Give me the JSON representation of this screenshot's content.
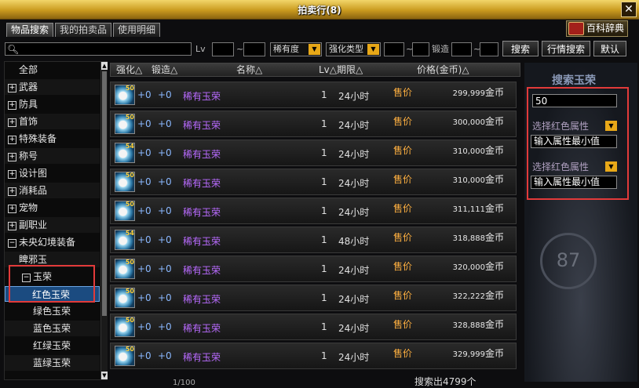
{
  "window": {
    "title": "拍卖行(8)",
    "close_symbol": "✕"
  },
  "tabs": [
    "物品搜索",
    "我的拍卖品",
    "使用明细"
  ],
  "encyclopedia": "百科辞典",
  "search": {
    "placeholder": "",
    "lv_label": "Lv",
    "lv_sep": "~",
    "rarity_label": "稀有度",
    "enhance_type_label": "强化类型",
    "forge_label": "锻造",
    "search_button": "搜索",
    "market_button": "行情搜索",
    "default_button": "默认"
  },
  "categories": [
    {
      "label": "全部",
      "box": ""
    },
    {
      "label": "武器",
      "box": "+"
    },
    {
      "label": "防具",
      "box": "+"
    },
    {
      "label": "首饰",
      "box": "+"
    },
    {
      "label": "特殊装备",
      "box": "+"
    },
    {
      "label": "称号",
      "box": "+"
    },
    {
      "label": "设计图",
      "box": "+"
    },
    {
      "label": "消耗品",
      "box": "+"
    },
    {
      "label": "宠物",
      "box": "+"
    },
    {
      "label": "副职业",
      "box": "+"
    },
    {
      "label": "未央幻境装备",
      "box": "−"
    },
    {
      "label": "睥邪玉",
      "box": ""
    },
    {
      "label": "玉荣",
      "box": "−"
    },
    {
      "label": "红色玉荣",
      "box": ""
    },
    {
      "label": "绿色玉荣",
      "box": ""
    },
    {
      "label": "蓝色玉荣",
      "box": ""
    },
    {
      "label": "红绿玉荣",
      "box": ""
    },
    {
      "label": "蓝绿玉荣",
      "box": ""
    }
  ],
  "table": {
    "headers": {
      "enhance": "强化△",
      "forge": "锻造△",
      "name": "名称△",
      "lv": "Lv△",
      "period": "期限△",
      "price": "价格(金币)△"
    },
    "rows": [
      {
        "level": "50",
        "enhance": "+0",
        "forge": "+0",
        "name": "稀有玉荣",
        "lv": "1",
        "period": "24小时",
        "price_label": "售价",
        "price": "299,999",
        "currency": "金币"
      },
      {
        "level": "50",
        "enhance": "+0",
        "forge": "+0",
        "name": "稀有玉荣",
        "lv": "1",
        "period": "24小时",
        "price_label": "售价",
        "price": "300,000",
        "currency": "金币"
      },
      {
        "level": "54",
        "enhance": "+0",
        "forge": "+0",
        "name": "稀有玉荣",
        "lv": "1",
        "period": "24小时",
        "price_label": "售价",
        "price": "310,000",
        "currency": "金币"
      },
      {
        "level": "50",
        "enhance": "+0",
        "forge": "+0",
        "name": "稀有玉荣",
        "lv": "1",
        "period": "24小时",
        "price_label": "售价",
        "price": "310,000",
        "currency": "金币"
      },
      {
        "level": "50",
        "enhance": "+0",
        "forge": "+0",
        "name": "稀有玉荣",
        "lv": "1",
        "period": "24小时",
        "price_label": "售价",
        "price": "311,111",
        "currency": "金币"
      },
      {
        "level": "54",
        "enhance": "+0",
        "forge": "+0",
        "name": "稀有玉荣",
        "lv": "1",
        "period": "48小时",
        "price_label": "售价",
        "price": "318,888",
        "currency": "金币"
      },
      {
        "level": "50",
        "enhance": "+0",
        "forge": "+0",
        "name": "稀有玉荣",
        "lv": "1",
        "period": "24小时",
        "price_label": "售价",
        "price": "320,000",
        "currency": "金币"
      },
      {
        "level": "50",
        "enhance": "+0",
        "forge": "+0",
        "name": "稀有玉荣",
        "lv": "1",
        "period": "24小时",
        "price_label": "售价",
        "price": "322,222",
        "currency": "金币"
      },
      {
        "level": "50",
        "enhance": "+0",
        "forge": "+0",
        "name": "稀有玉荣",
        "lv": "1",
        "period": "24小时",
        "price_label": "售价",
        "price": "328,888",
        "currency": "金币"
      },
      {
        "level": "50",
        "enhance": "+0",
        "forge": "+0",
        "name": "稀有玉荣",
        "lv": "1",
        "period": "24小时",
        "price_label": "售价",
        "price": "329,999",
        "currency": "金币"
      }
    ]
  },
  "pager": "1/100",
  "total": "搜索出4799个",
  "jade_panel": {
    "title": "搜索玉荣",
    "value": "50",
    "attr1_select": "选择红色属性",
    "attr1_min": "输入属性最小值",
    "attr2_select": "选择红色属性",
    "attr2_min": "输入属性最小值",
    "badge": "87"
  },
  "colors": {
    "highlight_box": "#e23a3a",
    "accent": "#e8a818"
  }
}
